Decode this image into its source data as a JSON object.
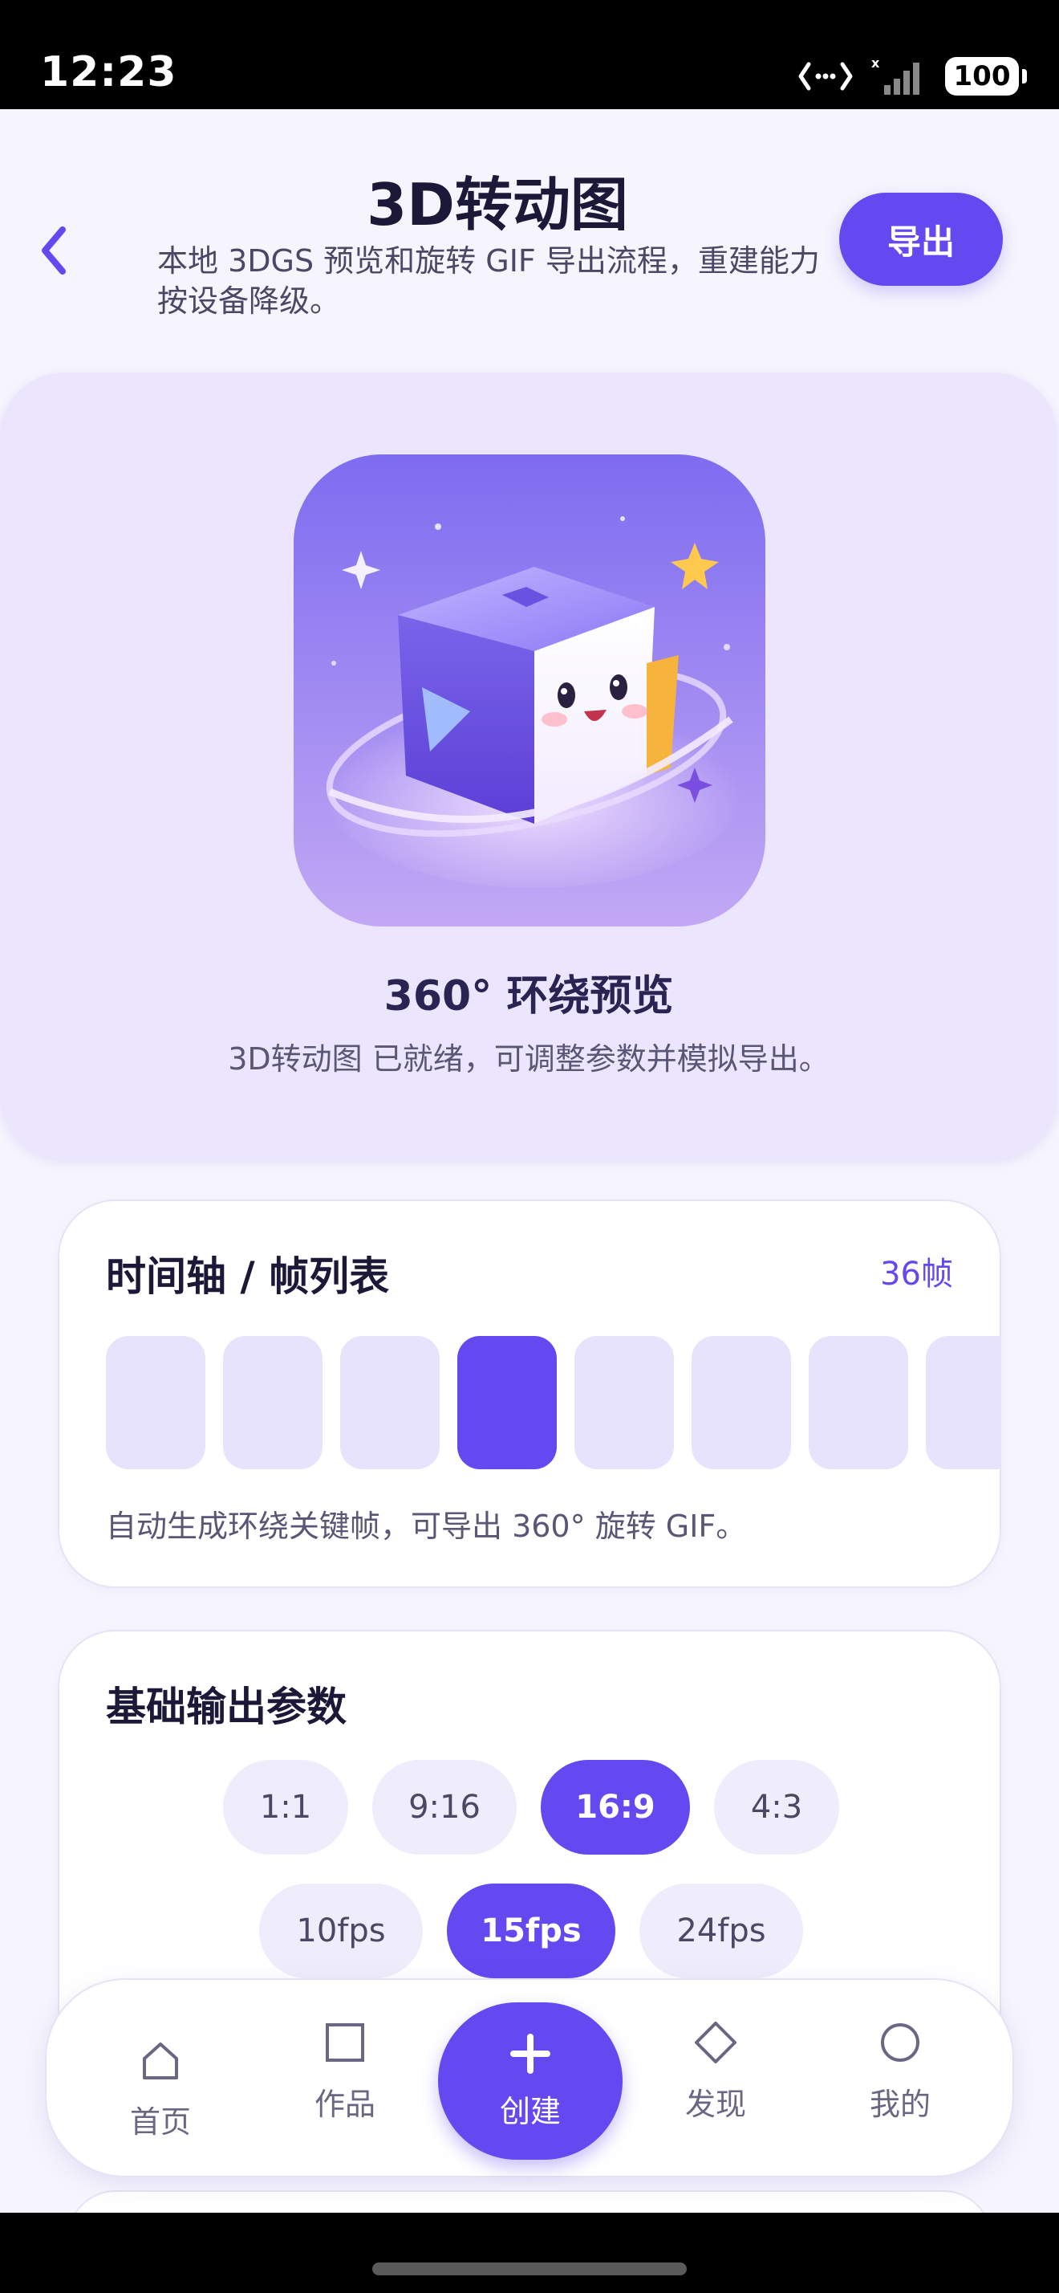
{
  "status_bar": {
    "time": "12:23",
    "battery": "100",
    "icons": [
      "network-arrows-icon",
      "signal-icon",
      "battery-icon"
    ]
  },
  "header": {
    "title": "3D转动图",
    "subtitle": "本地 3DGS 预览和旋转 GIF 导出流程，重建能力按设备降级。",
    "export_label": "导出",
    "back_icon": "chevron-left-icon"
  },
  "hero": {
    "title": "360° 环绕预览",
    "description": "3D转动图 已就绪，可调整参数并模拟导出。",
    "image_icon": "cube-mascot-illustration"
  },
  "timeline": {
    "title": "时间轴 / 帧列表",
    "frame_count": "36帧",
    "active_frame_index": 3,
    "visible_frames": 8,
    "note": "自动生成环绕关键帧，可导出 360° 旋转 GIF。"
  },
  "params": {
    "title": "基础输出参数",
    "ratios": [
      "1:1",
      "9:16",
      "16:9",
      "4:3"
    ],
    "selected_ratio": "16:9",
    "fps": [
      "10fps",
      "15fps",
      "24fps"
    ],
    "selected_fps": "15fps"
  },
  "bottom_nav": {
    "items": [
      {
        "label": "首页",
        "icon": "home-icon"
      },
      {
        "label": "作品",
        "icon": "square-icon"
      },
      {
        "label": "创建",
        "icon": "plus-icon"
      },
      {
        "label": "发现",
        "icon": "diamond-icon"
      },
      {
        "label": "我的",
        "icon": "circle-icon"
      }
    ]
  },
  "colors": {
    "accent": "#6448f0",
    "hero_bg": "#ebe6fd",
    "frame_idle": "#e8e3fd",
    "page_bg": "#f6f5fd"
  }
}
